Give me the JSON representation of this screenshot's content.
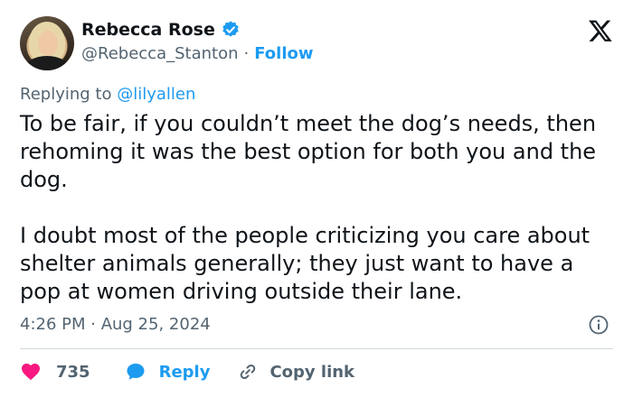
{
  "author": {
    "name": "Rebecca Rose",
    "handle": "@Rebecca_Stanton",
    "separator": "·",
    "follow_label": "Follow",
    "verified": true
  },
  "replying": {
    "prefix": "Replying to",
    "mention": "@lilyallen"
  },
  "tweet": {
    "paragraphs": [
      "To be fair, if you couldn’t meet the dog’s needs, then rehoming it was the best option for both you and the dog.",
      "I doubt most of the people criticizing you care about shelter animals generally; they just want to have a pop at women driving outside their lane."
    ],
    "timestamp": "4:26 PM · Aug 25, 2024"
  },
  "actions": {
    "likes_count": "735",
    "reply_label": "Reply",
    "copy_label": "Copy link"
  },
  "icons": {
    "verified": "verified-badge-icon",
    "logo": "x-logo-icon",
    "info": "info-icon",
    "like": "heart-icon",
    "reply": "reply-bubble-icon",
    "copy": "link-icon"
  },
  "colors": {
    "accent": "#1d9bf0",
    "like": "#f91880",
    "text": "#0f1419",
    "muted": "#536471"
  }
}
